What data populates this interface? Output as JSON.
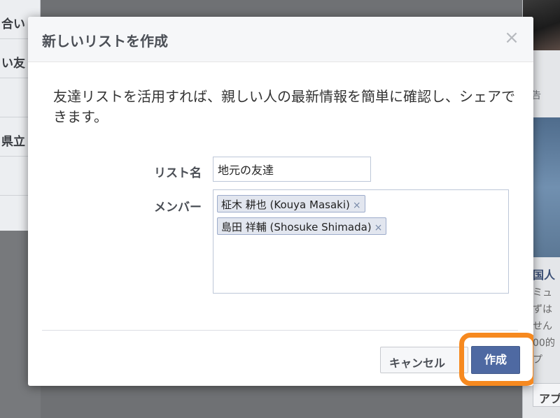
{
  "background": {
    "left_items": [
      "合い",
      "い友",
      "",
      "県立",
      ""
    ],
    "right_texts": [
      "告 ",
      "国人",
      "ミュ",
      "ずは",
      "せん",
      "00的",
      "プ"
    ],
    "right_button": "アプ"
  },
  "dialog": {
    "title": "新しいリストを作成",
    "close_symbol": "×",
    "description": "友達リストを活用すれば、親しい人の最新情報を簡単に確認し、シェアできます。",
    "list_name_label": "リスト名",
    "list_name_value": "地元の友達",
    "members_label": "メンバー",
    "members": [
      {
        "name": "柾木 耕也 (Kouya Masaki)"
      },
      {
        "name": "島田 祥輔 (Shosuke Shimada)"
      }
    ],
    "token_remove_symbol": "×",
    "cancel_label": "キャンセル",
    "create_label": "作成"
  },
  "colors": {
    "create_button": "#4e69a2",
    "highlight": "#f6891f",
    "overlay": "#6f7174"
  }
}
